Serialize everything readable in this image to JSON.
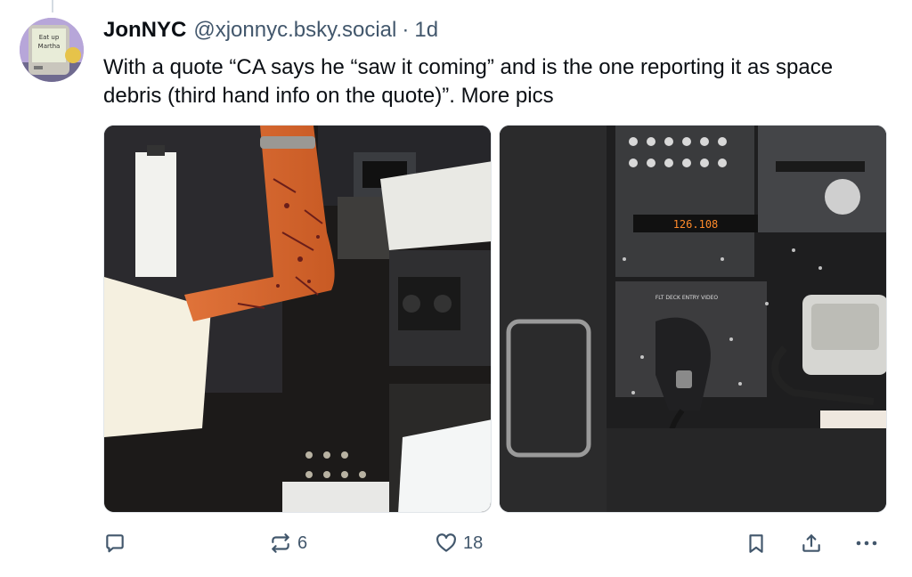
{
  "post": {
    "author": {
      "display_name": "JonNYC",
      "handle": "@xjonnyc.bsky.social",
      "avatar_text": [
        "Eat up",
        "Martha"
      ]
    },
    "separator": "·",
    "time_ago": "1d",
    "text": "With a quote “CA says he “saw it coming” and is the one reporting it as space debris (third hand info on the quote)”. More pics",
    "images": [
      {
        "icon": "photo-cut-arm-cockpit"
      },
      {
        "icon": "photo-cockpit-glass-debris",
        "panel_text": [
          "FLT DECK ENTRY VIDEO",
          "126.108"
        ]
      }
    ],
    "actions": {
      "reply_count": "",
      "repost_count": "6",
      "like_count": "18"
    }
  }
}
